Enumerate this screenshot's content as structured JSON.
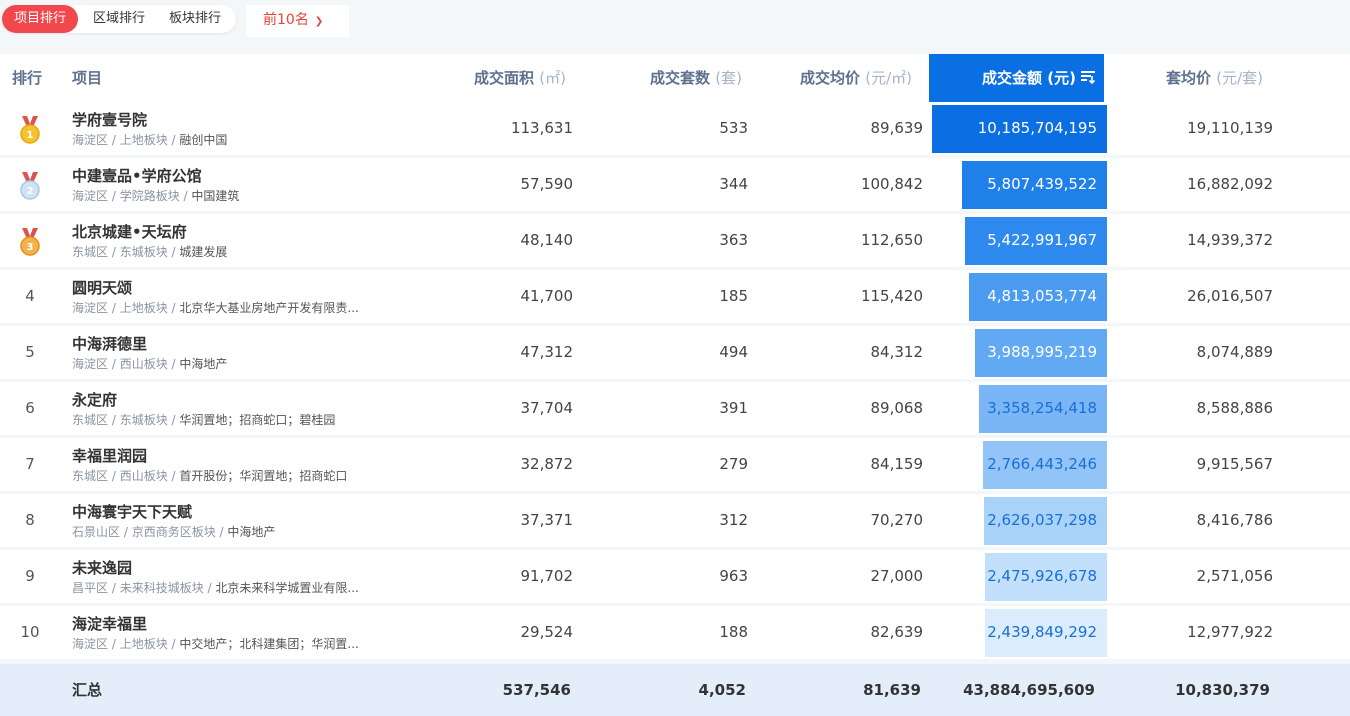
{
  "tabs": [
    {
      "label": "项目排行",
      "active": true
    },
    {
      "label": "区域排行",
      "active": false
    },
    {
      "label": "板块排行",
      "active": false
    }
  ],
  "dropdown": {
    "label": "前10名"
  },
  "columns": {
    "rank": "排行",
    "project": "项目",
    "area": {
      "label": "成交面积",
      "unit": "(㎡)"
    },
    "units": {
      "label": "成交套数",
      "unit": "(套)"
    },
    "avg_price": {
      "label": "成交均价",
      "unit": "(元/㎡)"
    },
    "amount": {
      "label": "成交金额",
      "unit": "(元)"
    },
    "unit_price": {
      "label": "套均价",
      "unit": "(元/套)"
    }
  },
  "colors": {
    "accent": "#f0484c",
    "sorted_header": "#0a6fe3"
  },
  "rows": [
    {
      "rank": "1",
      "medal": "gold-medal-icon",
      "name": "学府壹号院",
      "district": "海淀区",
      "block": "上地板块",
      "developer": "融创中国",
      "area": "113,631",
      "units": "533",
      "avg_price": "89,639",
      "amount": "10,185,704,195",
      "amount_value": 10185704195,
      "unit_price": "19,110,139"
    },
    {
      "rank": "2",
      "medal": "silver-medal-icon",
      "name": "中建壹品•学府公馆",
      "district": "海淀区",
      "block": "学院路板块",
      "developer": "中国建筑",
      "area": "57,590",
      "units": "344",
      "avg_price": "100,842",
      "amount": "5,807,439,522",
      "amount_value": 5807439522,
      "unit_price": "16,882,092"
    },
    {
      "rank": "3",
      "medal": "bronze-medal-icon",
      "name": "北京城建•天坛府",
      "district": "东城区",
      "block": "东城板块",
      "developer": "城建发展",
      "area": "48,140",
      "units": "363",
      "avg_price": "112,650",
      "amount": "5,422,991,967",
      "amount_value": 5422991967,
      "unit_price": "14,939,372"
    },
    {
      "rank": "4",
      "medal": "",
      "name": "圆明天颂",
      "district": "海淀区",
      "block": "上地板块",
      "developer": "北京华大基业房地产开发有限责...",
      "area": "41,700",
      "units": "185",
      "avg_price": "115,420",
      "amount": "4,813,053,774",
      "amount_value": 4813053774,
      "unit_price": "26,016,507"
    },
    {
      "rank": "5",
      "medal": "",
      "name": "中海湃德里",
      "district": "海淀区",
      "block": "西山板块",
      "developer": "中海地产",
      "area": "47,312",
      "units": "494",
      "avg_price": "84,312",
      "amount": "3,988,995,219",
      "amount_value": 3988995219,
      "unit_price": "8,074,889"
    },
    {
      "rank": "6",
      "medal": "",
      "name": "永定府",
      "district": "东城区",
      "block": "东城板块",
      "developer": "华润置地；招商蛇口；碧桂园",
      "area": "37,704",
      "units": "391",
      "avg_price": "89,068",
      "amount": "3,358,254,418",
      "amount_value": 3358254418,
      "unit_price": "8,588,886"
    },
    {
      "rank": "7",
      "medal": "",
      "name": "幸福里润园",
      "district": "东城区",
      "block": "西山板块",
      "developer": "首开股份；华润置地；招商蛇口",
      "area": "32,872",
      "units": "279",
      "avg_price": "84,159",
      "amount": "2,766,443,246",
      "amount_value": 2766443246,
      "unit_price": "9,915,567"
    },
    {
      "rank": "8",
      "medal": "",
      "name": "中海寰宇天下天赋",
      "district": "石景山区",
      "block": "京西商务区板块",
      "developer": "中海地产",
      "area": "37,371",
      "units": "312",
      "avg_price": "70,270",
      "amount": "2,626,037,298",
      "amount_value": 2626037298,
      "unit_price": "8,416,786"
    },
    {
      "rank": "9",
      "medal": "",
      "name": "未来逸园",
      "district": "昌平区",
      "block": "未来科技城板块",
      "developer": "北京未来科学城置业有限...",
      "area": "91,702",
      "units": "963",
      "avg_price": "27,000",
      "amount": "2,475,926,678",
      "amount_value": 2475926678,
      "unit_price": "2,571,056"
    },
    {
      "rank": "10",
      "medal": "",
      "name": "海淀幸福里",
      "district": "海淀区",
      "block": "上地板块",
      "developer": "中交地产；北科建集团；华润置...",
      "area": "29,524",
      "units": "188",
      "avg_price": "82,639",
      "amount": "2,439,849,292",
      "amount_value": 2439849292,
      "unit_price": "12,977,922"
    }
  ],
  "total": {
    "label": "汇总",
    "area": "537,546",
    "units": "4,052",
    "avg_price": "81,639",
    "amount": "43,884,695,609",
    "unit_price": "10,830,379"
  }
}
